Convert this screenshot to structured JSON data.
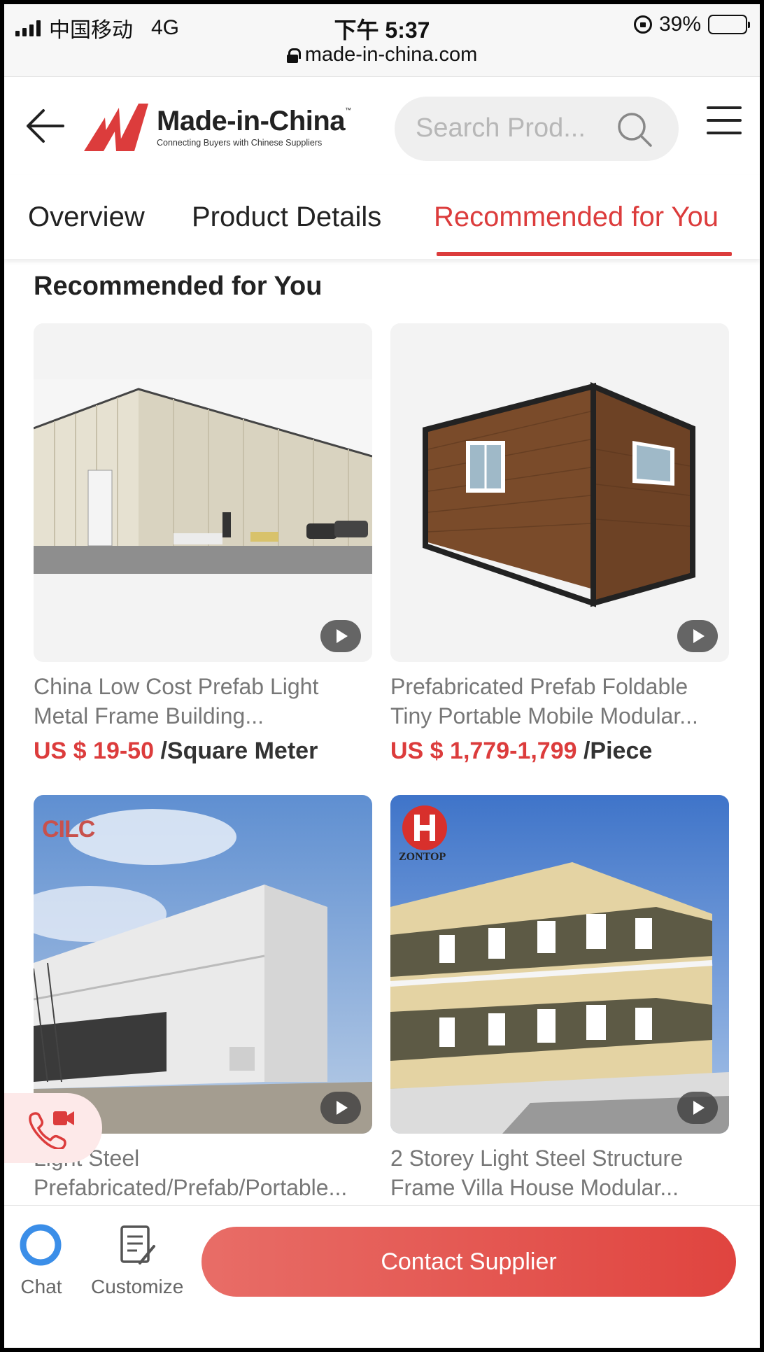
{
  "status_bar": {
    "carrier": "中国移动",
    "network": "4G",
    "time": "下午 5:37",
    "battery": "39%",
    "battery_level": 0.39,
    "url": "made-in-china.com"
  },
  "header": {
    "logo_name": "Made-in-China",
    "logo_tm": "™",
    "logo_tagline": "Connecting Buyers with Chinese Suppliers",
    "search_placeholder": "Search Prod..."
  },
  "tabs": [
    {
      "label": "Overview",
      "active": false
    },
    {
      "label": "Product Details",
      "active": false
    },
    {
      "label": "Recommended for You",
      "active": true
    }
  ],
  "section_title": "Recommended for You",
  "products": [
    {
      "title_line1": "China Low Cost Prefab Light",
      "title_line2": "Metal Frame Building...",
      "price": "US $ 19-50",
      "unit": "/Square Meter",
      "has_video": true,
      "image": "steel-warehouse"
    },
    {
      "title_line1": "Prefabricated Prefab Foldable",
      "title_line2": "Tiny Portable Mobile Modular...",
      "price": "US $ 1,779-1,799",
      "unit": "/Piece",
      "has_video": true,
      "image": "container-house"
    },
    {
      "title_line1": "Light Steel",
      "title_line2": "Prefabricated/Prefab/Portable...",
      "has_video": true,
      "image": "two-storey-container-building",
      "watermark": "CILC"
    },
    {
      "title_line1": "2 Storey Light Steel Structure",
      "title_line2": "Frame Villa House Modular...",
      "has_video": true,
      "image": "two-storey-villa",
      "watermark": "ZONTOP"
    }
  ],
  "bottom_bar": {
    "chat_label": "Chat",
    "customize_label": "Customize",
    "contact_label": "Contact Supplier"
  },
  "colors": {
    "accent": "#dc3c3c",
    "contact_gradient_start": "#e86d67",
    "contact_gradient_end": "#e0443f",
    "chat_icon": "#3b8ee8"
  }
}
